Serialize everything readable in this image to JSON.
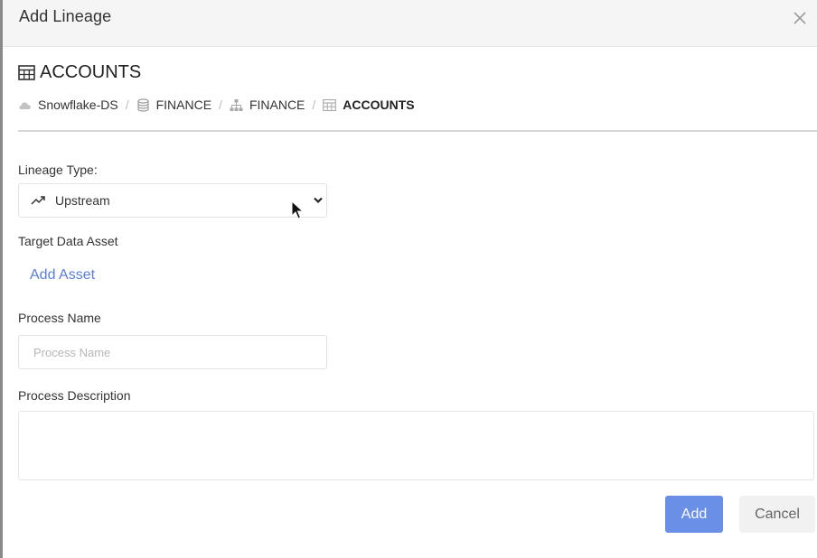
{
  "modal": {
    "title": "Add Lineage",
    "close_icon": "close-icon"
  },
  "asset": {
    "icon": "table-icon",
    "name": "ACCOUNTS"
  },
  "breadcrumb": [
    {
      "icon": "cloud-icon",
      "label": "Snowflake-DS"
    },
    {
      "icon": "database-icon",
      "label": "FINANCE"
    },
    {
      "icon": "schema-icon",
      "label": "FINANCE"
    },
    {
      "icon": "table-icon",
      "label": "ACCOUNTS"
    }
  ],
  "breadcrumb_separator": "/",
  "form": {
    "lineage_type_label": "Lineage Type:",
    "lineage_type_value": "Upstream",
    "lineage_type_icon": "trending-up-icon",
    "target_label": "Target Data Asset",
    "add_asset_link": "Add Asset",
    "process_name_label": "Process Name",
    "process_name_placeholder": "Process Name",
    "process_name_value": "",
    "process_description_label": "Process Description",
    "process_description_value": ""
  },
  "buttons": {
    "add": "Add",
    "cancel": "Cancel"
  },
  "colors": {
    "accent": "#6a8fe6",
    "link": "#5b7ed8",
    "header_bg": "#f5f5f5"
  }
}
